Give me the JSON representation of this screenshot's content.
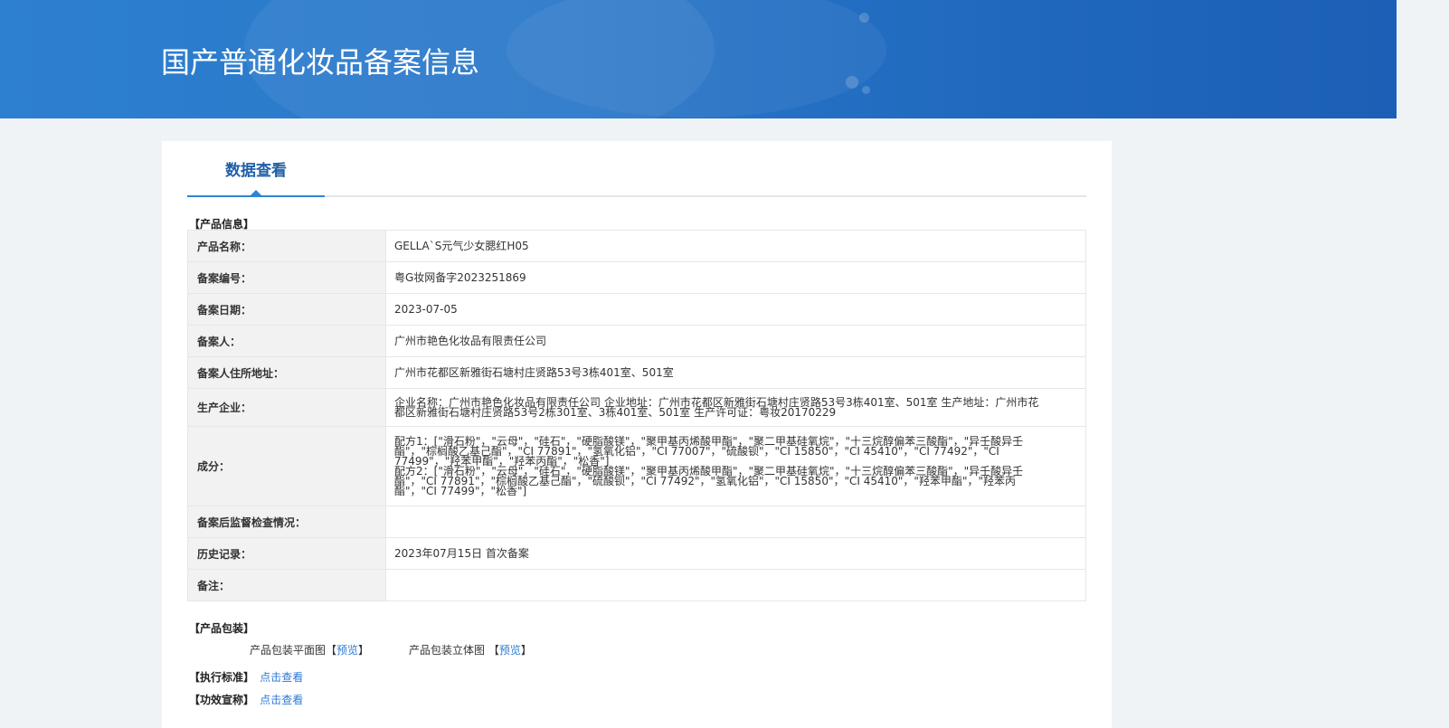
{
  "banner": {
    "title": "国产普通化妆品备案信息"
  },
  "tabs": [
    {
      "label": "数据查看"
    }
  ],
  "sections": {
    "product_info": "【产品信息】",
    "packaging": "【产品包装】",
    "standard": "【执行标准】",
    "efficacy": "【功效宣称】"
  },
  "rows": [
    {
      "key": "产品名称：",
      "value": "GELLA`S元气少女腮红H05"
    },
    {
      "key": "备案编号：",
      "value": "粤G妆网备字2023251869"
    },
    {
      "key": "备案日期：",
      "value": "2023-07-05"
    },
    {
      "key": "备案人：",
      "value": "广州市艳色化妆品有限责任公司"
    },
    {
      "key": "备案人住所地址：",
      "value": "广州市花都区新雅街石塘村庄贤路53号3栋401室、501室"
    },
    {
      "key": "生产企业：",
      "value": "企业名称：广州市艳色化妆品有限责任公司 企业地址：广州市花都区新雅街石塘村庄贤路53号3栋401室、501室 生产地址：广州市花都区新雅街石塘村庄贤路53号2栋301室、3栋401室、501室 生产许可证：粤妆20170229"
    },
    {
      "key": "成分：",
      "value_lines": [
        "配方1：[\"滑石粉\"，\"云母\"，\"硅石\"，\"硬脂酸镁\"，\"聚甲基丙烯酸甲酯\"，\"聚二甲基硅氧烷\"，\"十三烷醇偏苯三酸酯\"，\"异壬酸异壬酯\"，\"棕榈酸乙基己酯\"，\"CI 77891\"，\"氢氧化铝\"，\"CI 77007\"，\"硫酸钡\"，\"CI 15850\"，\"CI 45410\"，\"CI 77492\"，\"CI 77499\"，\"羟苯甲酯\"，\"羟苯丙酯\"，\"松香\"]",
        "配方2：[\"滑石粉\"，\"云母\"，\"硅石\"，\"硬脂酸镁\"，\"聚甲基丙烯酸甲酯\"，\"聚二甲基硅氧烷\"，\"十三烷醇偏苯三酸酯\"，\"异壬酸异壬酯\"，\"CI 77891\"，\"棕榈酸乙基己酯\"，\"硫酸钡\"，\"CI 77492\"，\"氢氧化铝\"，\"CI 15850\"，\"CI 45410\"，\"羟苯甲酯\"，\"羟苯丙酯\"，\"CI 77499\"，\"松香\"]"
      ]
    },
    {
      "key": "备案后监督检查情况：",
      "value": ""
    },
    {
      "key": "历史记录：",
      "value": "2023年07月15日 首次备案"
    },
    {
      "key": "备注：",
      "value": ""
    }
  ],
  "packaging": {
    "flat_label": "产品包装平面图",
    "solid_label": "产品包装立体图",
    "bracket_open": "【",
    "bracket_close": "】",
    "preview": "预览"
  },
  "links": {
    "view": "点击查看"
  },
  "colors": {
    "banner": "#2a78c9",
    "accent": "#2e84d6",
    "link": "#2d7ad6",
    "key_bg": "#f2f2f2"
  }
}
